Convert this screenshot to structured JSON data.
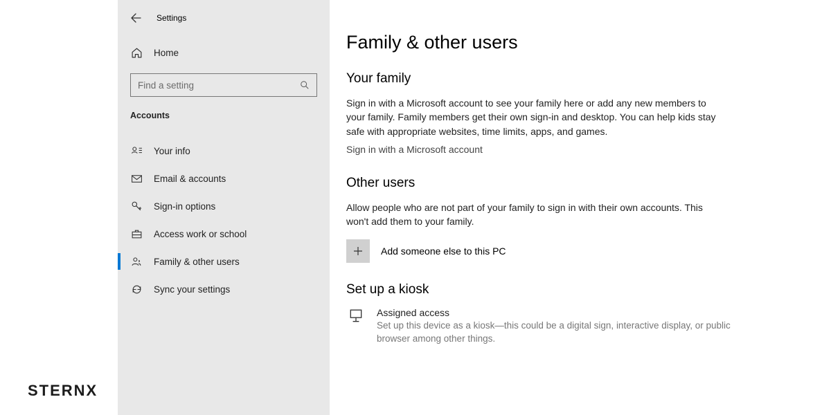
{
  "brand": "STERNX",
  "topbar": {
    "title": "Settings"
  },
  "sidebar": {
    "home_label": "Home",
    "search_placeholder": "Find a setting",
    "section_label": "Accounts",
    "items": [
      {
        "label": "Your info"
      },
      {
        "label": "Email & accounts"
      },
      {
        "label": "Sign-in options"
      },
      {
        "label": "Access work or school"
      },
      {
        "label": "Family & other users"
      },
      {
        "label": "Sync your settings"
      }
    ]
  },
  "main": {
    "title": "Family & other users",
    "family": {
      "heading": "Your family",
      "desc": "Sign in with a Microsoft account to see your family here or add any new members to your family. Family members get their own sign-in and desktop. You can help kids stay safe with appropriate websites, time limits, apps, and games.",
      "signin_link": "Sign in with a Microsoft account"
    },
    "other": {
      "heading": "Other users",
      "desc": "Allow people who are not part of your family to sign in with their own accounts. This won't add them to your family.",
      "add_label": "Add someone else to this PC"
    },
    "kiosk": {
      "heading": "Set up a kiosk",
      "item_title": "Assigned access",
      "item_desc": "Set up this device as a kiosk—this could be a digital sign, interactive display, or public browser among other things."
    }
  }
}
